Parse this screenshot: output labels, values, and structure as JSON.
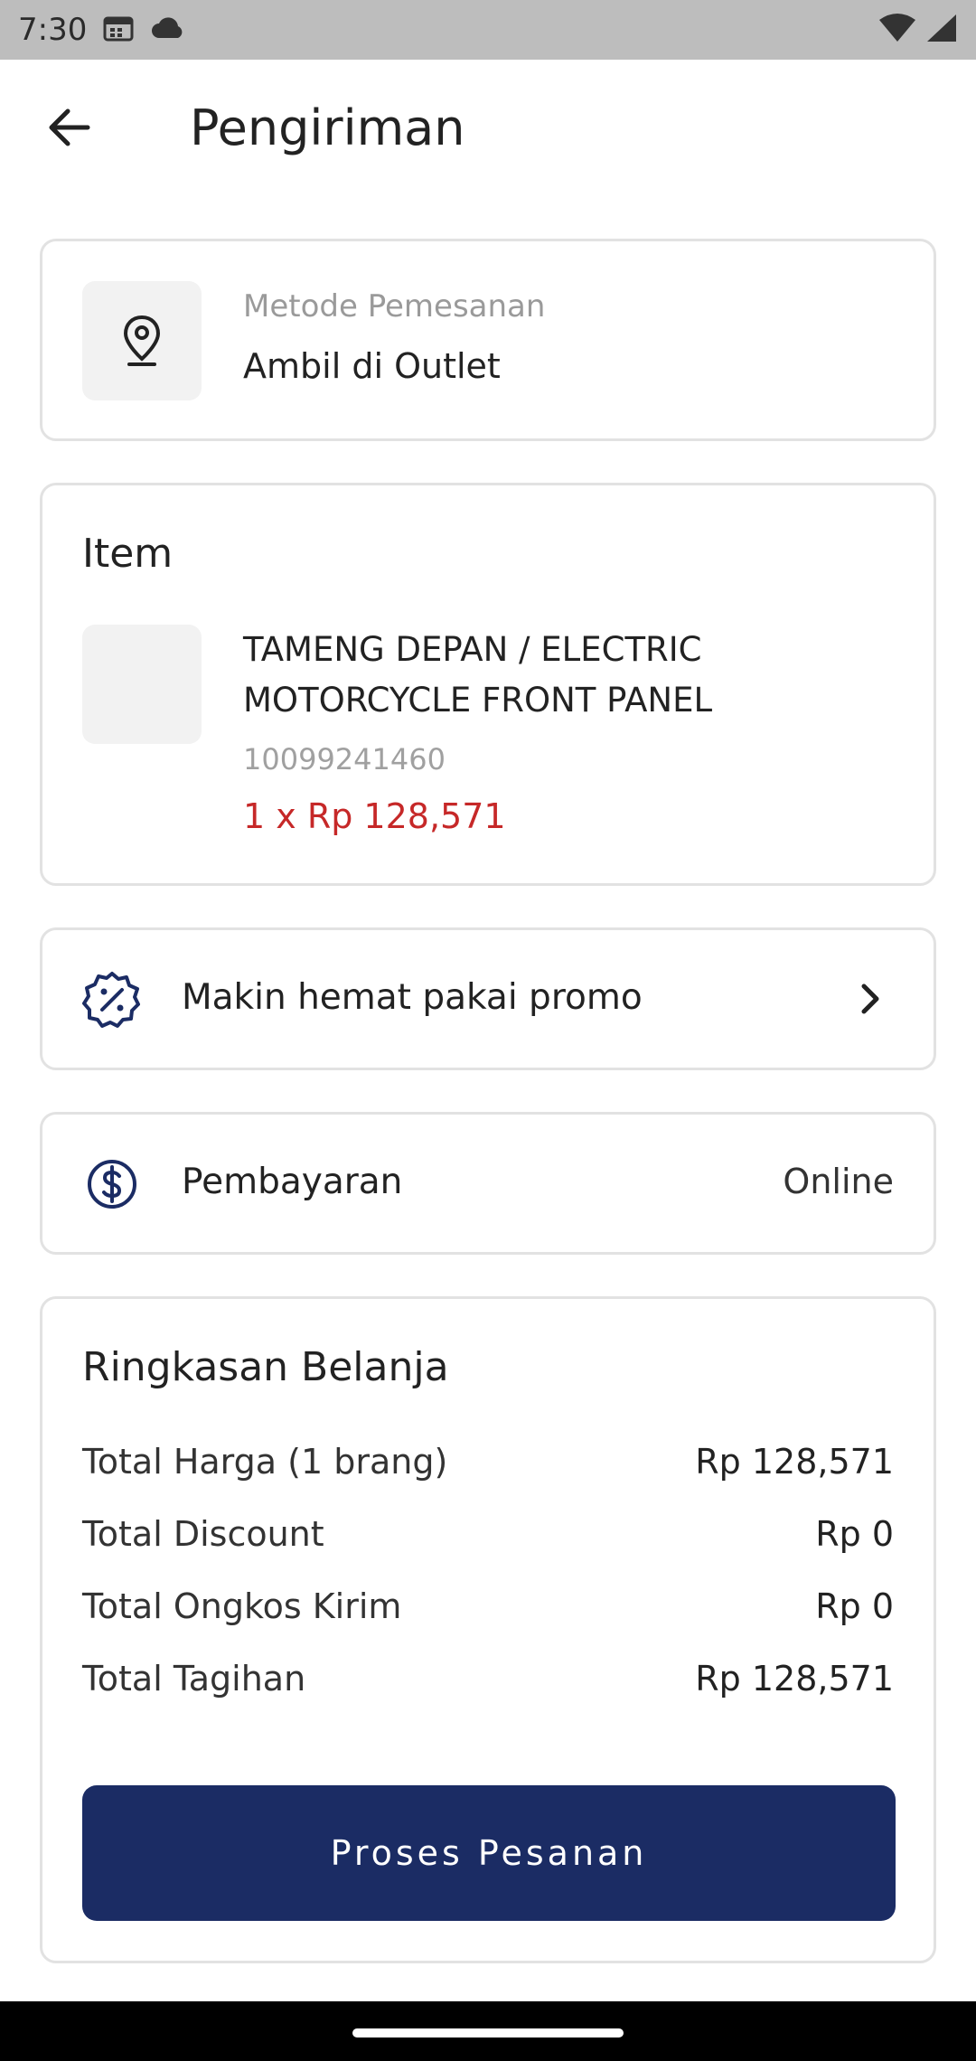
{
  "status_bar": {
    "time": "7:30",
    "icons": [
      "calendar-icon",
      "cloud-icon",
      "wifi-icon",
      "signal-icon"
    ]
  },
  "header": {
    "title": "Pengiriman",
    "back_icon": "arrow-left-icon"
  },
  "order_method": {
    "label": "Metode Pemesanan",
    "value": "Ambil di Outlet",
    "icon": "location-pin-icon"
  },
  "item_section": {
    "title": "Item",
    "product": {
      "name": "TAMENG DEPAN / ELECTRIC MOTORCYCLE FRONT PANEL",
      "sku": "10099241460",
      "price_line": "1 x Rp 128,571"
    }
  },
  "promo": {
    "label": "Makin hemat pakai promo",
    "icon": "promo-percent-icon"
  },
  "payment": {
    "label": "Pembayaran",
    "value": "Online",
    "icon": "dollar-circle-icon"
  },
  "summary": {
    "title": "Ringkasan Belanja",
    "rows": [
      {
        "label": "Total Harga (1 brang)",
        "value": "Rp 128,571"
      },
      {
        "label": "Total Discount",
        "value": "Rp 0"
      },
      {
        "label": "Total Ongkos Kirim",
        "value": "Rp 0"
      },
      {
        "label": "Total Tagihan",
        "value": "Rp 128,571"
      }
    ],
    "button_label": "Proses Pesanan"
  },
  "colors": {
    "primary": "#1b2c64",
    "price_red": "#c62828",
    "border": "#e2e2e2"
  }
}
